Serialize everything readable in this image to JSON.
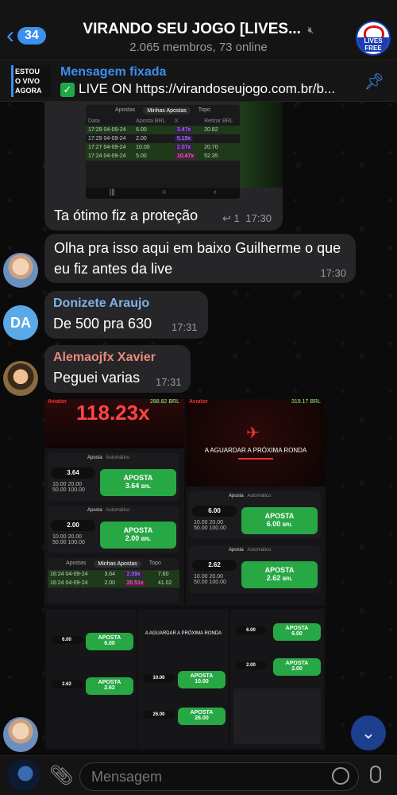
{
  "header": {
    "back_count": "34",
    "title": "VIRANDO SEU JOGO [LIVES...",
    "subtitle": "2.065 membros, 73 online",
    "avatar_label": "LIVES FREE"
  },
  "pinned": {
    "label": "Mensagem fixada",
    "text": "LIVE ON https://virandoseujogo.com.br/b...",
    "thumb_text": "ESTOU\nO VIVO\nAGORA"
  },
  "messages": [
    {
      "text": "Ta ótimo fiz a proteção",
      "reply_count": "1",
      "time": "17:30"
    },
    {
      "text": "Olha pra isso aqui em baixo Guilherme o que eu fiz antes da live",
      "time": "17:30"
    },
    {
      "sender": "Donizete Araujo",
      "sender_color": "#7fb2e8",
      "avatar_initials": "DA",
      "text": "De 500 pra 630",
      "time": "17:31"
    },
    {
      "sender": "Alemaojfx Xavier",
      "sender_color": "#e88a7c",
      "text": "Peguei varias",
      "time": "17:31"
    }
  ],
  "shot_top": {
    "tabs": [
      "Apostas",
      "Minhas Apostas",
      "Topo"
    ],
    "columns": [
      "Data",
      "Aposta BRL",
      "X",
      "Retirar BRL"
    ],
    "rows": [
      {
        "date": "17:29 04-09-24",
        "bet": "6.00",
        "mult": "3.47x",
        "cashout": "20.82",
        "win": true
      },
      {
        "date": "17:29 04-09-24",
        "bet": "2.00",
        "mult": "5.19x",
        "cashout": "",
        "win": false
      },
      {
        "date": "17:27 04-09-24",
        "bet": "10.00",
        "mult": "2.07x",
        "cashout": "20.70",
        "win": true
      },
      {
        "date": "17:24 04-09-24",
        "bet": "5.00",
        "mult": "10.47x",
        "cashout": "52.35",
        "win": true
      }
    ]
  },
  "shot_big": {
    "multiplier": "118.23x",
    "balance_left": "288.82 BRL",
    "balance_right": "319.17 BRL",
    "waiting_text": "A AGUARDAR A PRÓXIMA RONDA",
    "mode_aposta": "Aposta",
    "mode_auto": "Automático",
    "bets_left": [
      {
        "value": "3.64",
        "button": "APOSTA",
        "amount": "3.64",
        "currency": "BRL"
      },
      {
        "value": "2.00",
        "button": "APOSTA",
        "amount": "2.00",
        "currency": "BRL"
      }
    ],
    "bets_right": [
      {
        "value": "6.00",
        "button": "APOSTA",
        "amount": "6.00",
        "currency": "BRL"
      },
      {
        "value": "2.62",
        "button": "APOSTA",
        "amount": "2.62",
        "currency": "BRL"
      }
    ],
    "chips": [
      "10.00",
      "20.00",
      "50.00",
      "100.00"
    ],
    "tabs": [
      "Apostas",
      "Minhas Apostas",
      "Topo"
    ],
    "rows": [
      {
        "date": "16:24 04-09-24",
        "bet": "3.64",
        "mult": "2.09x",
        "cashout": "7.60"
      },
      {
        "date": "16:24 04-09-24",
        "bet": "2.00",
        "mult": "20.51x",
        "cashout": "41.02"
      }
    ]
  },
  "shot_small": {
    "waiting_text": "A AGUARDAR A PRÓXIMA RONDA",
    "bets": [
      {
        "value": "6.00",
        "amount": "6.00"
      },
      {
        "value": "2.62",
        "amount": "2.62"
      },
      {
        "value": "10.00",
        "amount": "10.00"
      },
      {
        "value": "26.00",
        "amount": "26.00"
      },
      {
        "value": "6.00",
        "amount": "6.00"
      },
      {
        "value": "2.00",
        "amount": "2.00"
      }
    ]
  },
  "composer": {
    "placeholder": "Mensagem"
  }
}
